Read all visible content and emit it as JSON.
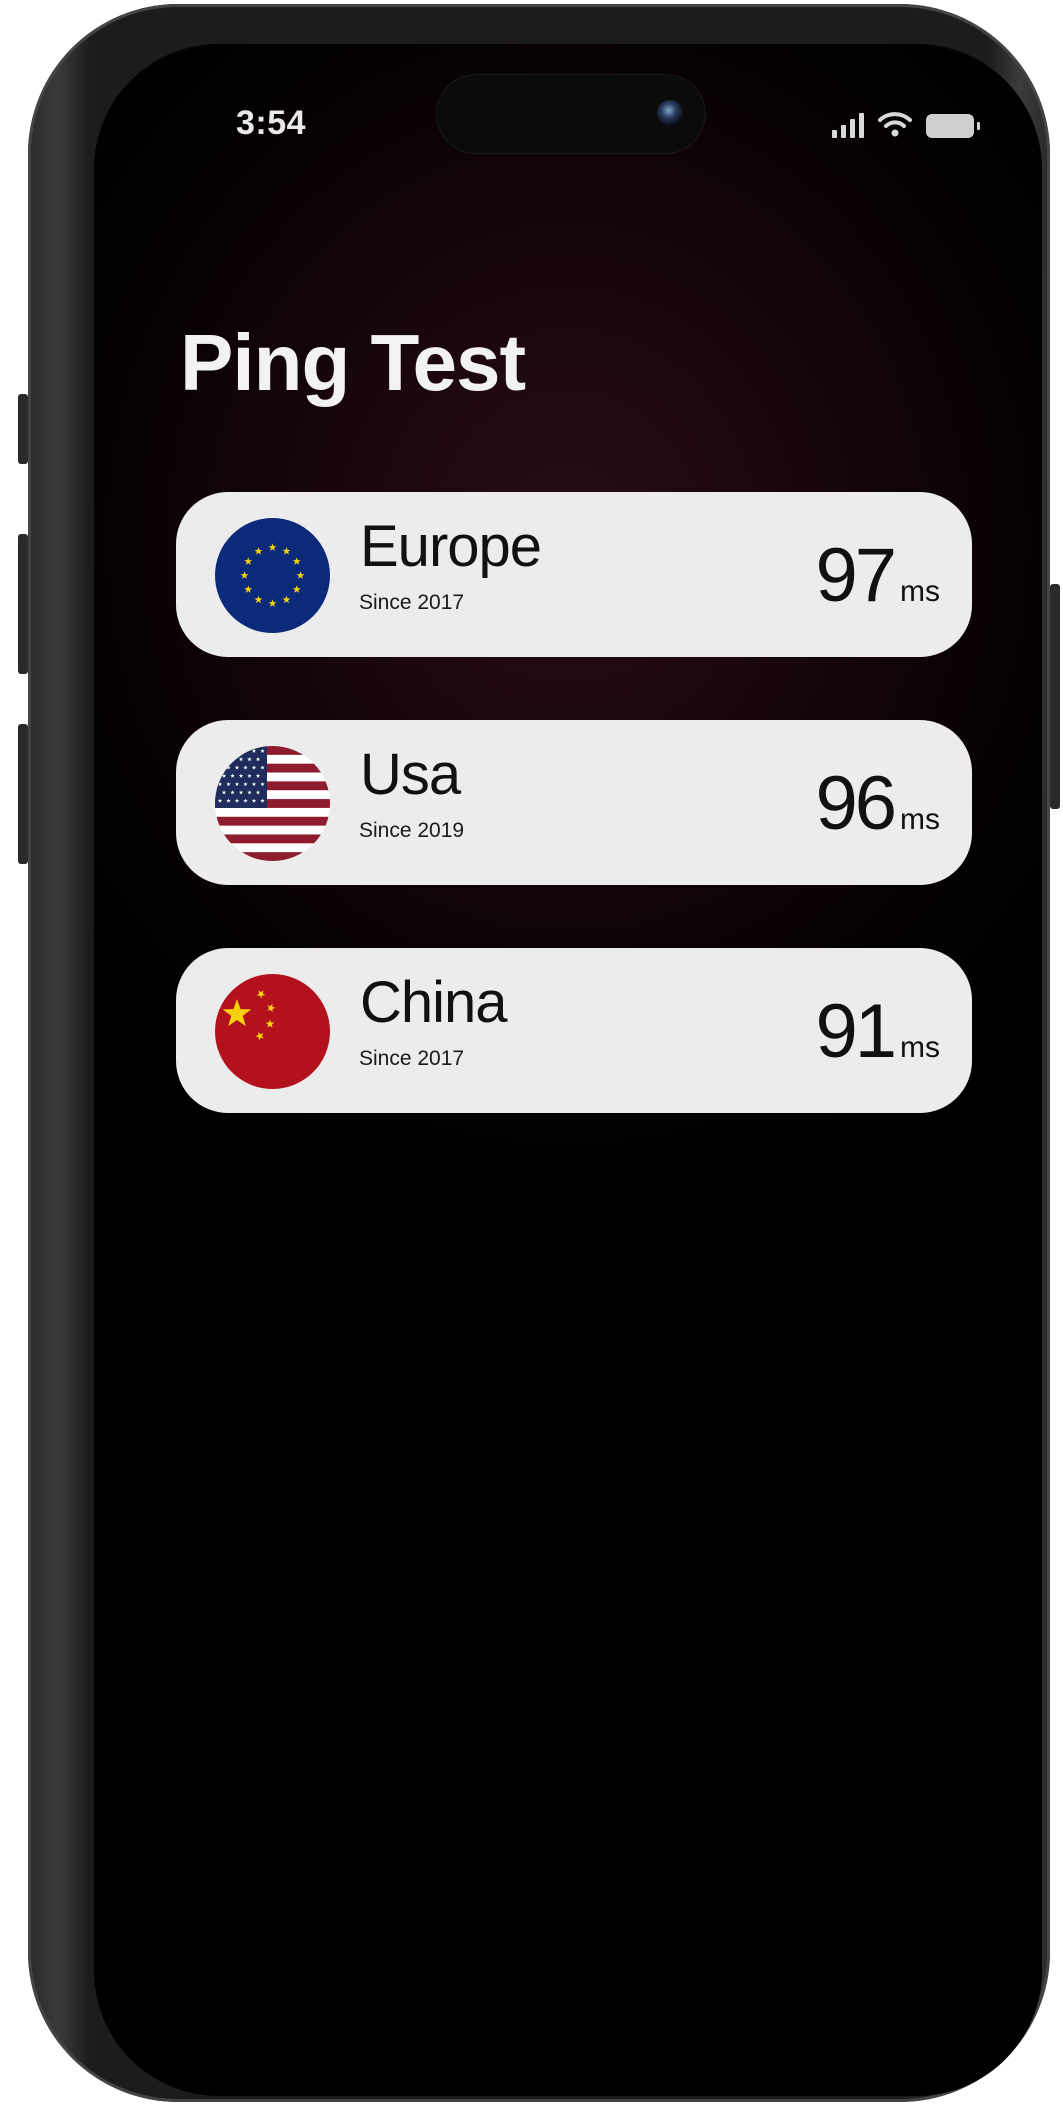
{
  "status_bar": {
    "time": "3:54"
  },
  "page": {
    "title": "Ping Test"
  },
  "regions": [
    {
      "name": "Europe",
      "since": "Since 2017",
      "ping": "97",
      "unit": "ms",
      "flag_icon": "eu-flag-icon"
    },
    {
      "name": "Usa",
      "since": "Since 2019",
      "ping": "96",
      "unit": "ms",
      "flag_icon": "us-flag-icon"
    },
    {
      "name": "China",
      "since": "Since 2017",
      "ping": "91",
      "unit": "ms",
      "flag_icon": "china-flag-icon"
    }
  ],
  "colors": {
    "card_background": "#ececec",
    "eu_blue": "#0b2a7a",
    "us_red": "#8e1b2e",
    "china_red": "#b3111c",
    "star_yellow": "#f5d20b"
  }
}
